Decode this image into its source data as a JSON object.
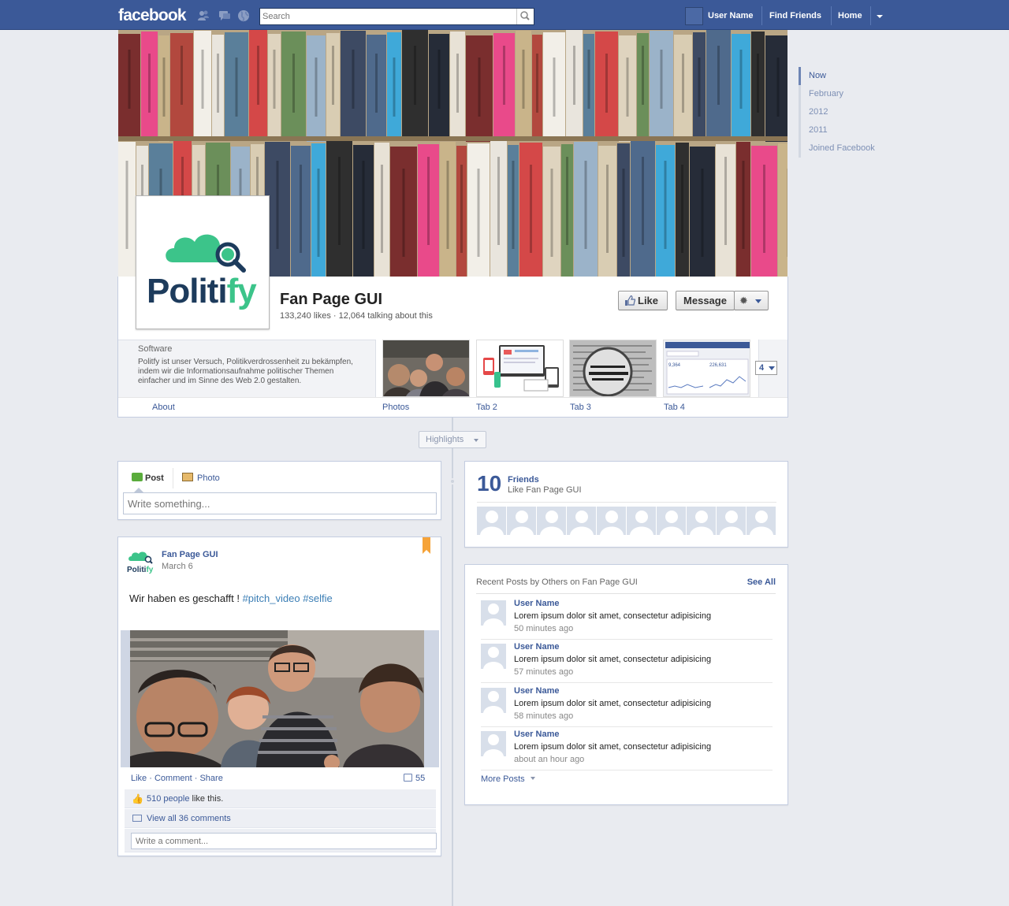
{
  "topbar": {
    "logo": "facebook",
    "search_placeholder": "Search",
    "user_name": "User Name",
    "find_friends": "Find Friends",
    "home": "Home"
  },
  "timeline_nav": [
    "Now",
    "February",
    "2012",
    "2011",
    "Joined Facebook"
  ],
  "profile": {
    "logo_text": "Politify",
    "name": "Fan Page GUI",
    "stats": "133,240 likes · 12,064 talking about this",
    "like_label": "Like",
    "message_label": "Message"
  },
  "about": {
    "category": "Software",
    "description": "Politfy ist unser Versuch, Politikverdrossenheit zu bekämpfen, indem wir die Informationsaufnahme politischer Themen einfacher und im Sinne des Web 2.0 gestalten.",
    "label": "About"
  },
  "apps": {
    "tabs": [
      "Photos",
      "Tab 2",
      "Tab 3",
      "Tab 4"
    ],
    "more_count": "4"
  },
  "highlights": "Highlights",
  "composer": {
    "post_tab": "Post",
    "photo_tab": "Photo",
    "placeholder": "Write something..."
  },
  "post": {
    "author": "Fan Page GUI",
    "date": "March 6",
    "text": "Wir haben es geschafft !",
    "hashtags": "#pitch_video #selfie",
    "actions": [
      "Like",
      "Comment",
      "Share"
    ],
    "comment_count": "55",
    "likes_count": "510 people",
    "likes_suffix": " like this.",
    "view_comments": "View all 36 comments",
    "comment_placeholder": "Write a comment..."
  },
  "friends": {
    "count": "10",
    "title": "Friends",
    "subtitle": "Like Fan Page GUI"
  },
  "recent_posts": {
    "title": "Recent Posts by Others on Fan Page GUI",
    "see_all": "See All",
    "items": [
      {
        "name": "User Name",
        "text": "Lorem ipsum dolor sit amet, consectetur adipisicing",
        "time": "50 minutes ago"
      },
      {
        "name": "User Name",
        "text": "Lorem ipsum dolor sit amet, consectetur adipisicing",
        "time": "57 minutes ago"
      },
      {
        "name": "User Name",
        "text": "Lorem ipsum dolor sit amet, consectetur adipisicing",
        "time": "58 minutes ago"
      },
      {
        "name": "User Name",
        "text": "Lorem ipsum dolor sit amet, consectetur adipisicing",
        "time": "about an hour ago"
      }
    ],
    "more_posts": "More Posts"
  },
  "colors": {
    "brand_blue": "#3b5998",
    "politify_green": "#3cc48a",
    "politify_navy": "#1d3b5c"
  }
}
